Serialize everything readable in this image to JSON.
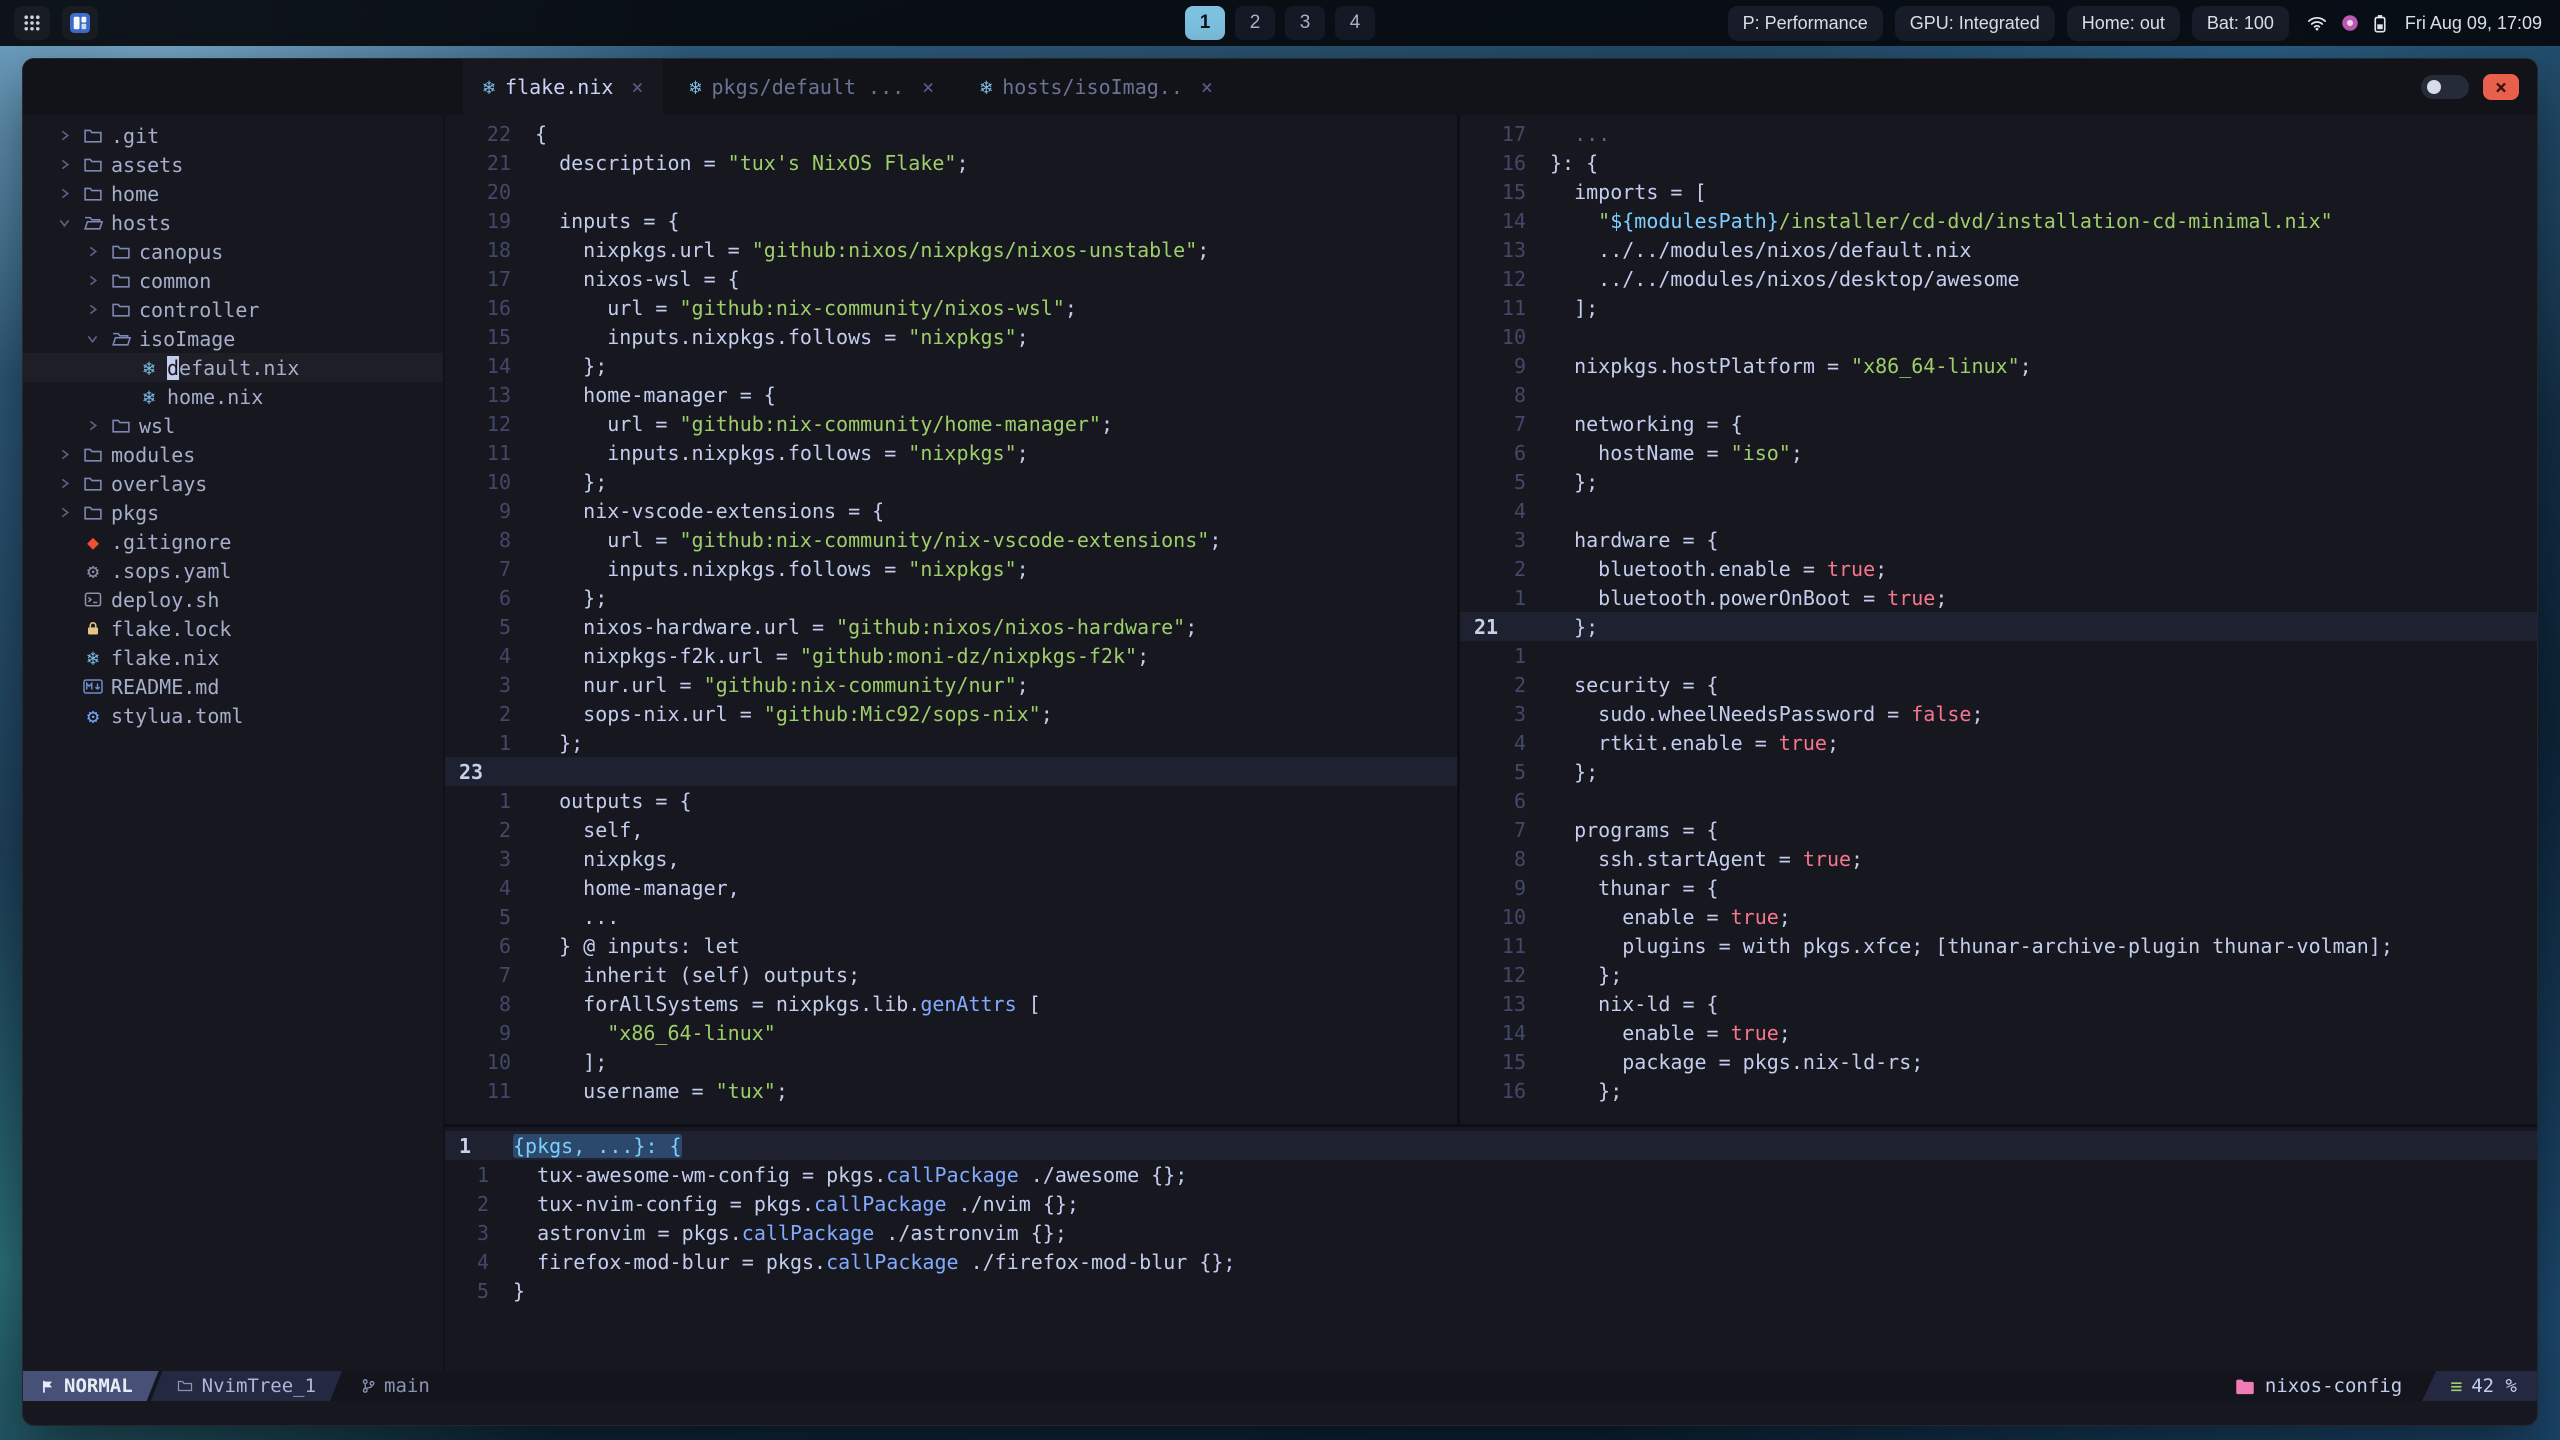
{
  "colors": {
    "bg_editor": "#16171f",
    "bg_tabbar": "#121319",
    "bg_statusline": "#14151c",
    "fg": "#c3cdee",
    "dim": "#5a6285",
    "linenr": "#424968",
    "linenr_active": "#c8d0ea",
    "string": "#9ece6a",
    "boolean": "#f7768e",
    "cyan": "#7dcfff",
    "func": "#82aaff",
    "accent": "#7fc4e4",
    "close": "#e8604c",
    "pink": "#ef7cb5",
    "mode_bg": "#475177",
    "seg_bg": "#242941",
    "tree_fg": "#a5aecb",
    "cursorline": "#1e2130",
    "selection": "#2c486a"
  },
  "icons": {
    "nix": "❄",
    "git": "◆",
    "gear": "⚙",
    "progress": "≡",
    "close_tab": "×",
    "close_window": "×"
  },
  "topbar": {
    "workspaces": [
      "1",
      "2",
      "3",
      "4"
    ],
    "active_workspace": "1",
    "status_pills": [
      "P: Performance",
      "GPU: Integrated",
      "Home: out",
      "Bat: 100"
    ],
    "clock": "Fri Aug 09, 17:09"
  },
  "window": {
    "tabs": [
      {
        "label": "flake.nix",
        "active": true
      },
      {
        "label": "pkgs/default ...",
        "active": false
      },
      {
        "label": "hosts/isoImag..",
        "active": false
      }
    ],
    "filetree": {
      "icon_colors": {
        "folder": "#7e88b5",
        "folder-open": "#7e88b5",
        "nix": "#7ebae4",
        "git": "#f14e32",
        "gear": "#8a91a8",
        "terminal": "#8a91a8",
        "lock": "#e6c384",
        "markdown": "#6d8ccc"
      },
      "items": [
        {
          "level": 0,
          "kind": "dir",
          "chev": "right",
          "icon": "folder",
          "label": ".git"
        },
        {
          "level": 0,
          "kind": "dir",
          "chev": "right",
          "icon": "folder",
          "label": "assets"
        },
        {
          "level": 0,
          "kind": "dir",
          "chev": "right",
          "icon": "folder",
          "label": "home"
        },
        {
          "level": 0,
          "kind": "dir",
          "chev": "down",
          "icon": "folder-open",
          "label": "hosts"
        },
        {
          "level": 1,
          "kind": "dir",
          "chev": "right",
          "icon": "folder",
          "label": "canopus"
        },
        {
          "level": 1,
          "kind": "dir",
          "chev": "right",
          "icon": "folder",
          "label": "common"
        },
        {
          "level": 1,
          "kind": "dir",
          "chev": "right",
          "icon": "folder",
          "label": "controller"
        },
        {
          "level": 1,
          "kind": "dir",
          "chev": "down",
          "icon": "folder-open",
          "label": "isoImage"
        },
        {
          "level": 2,
          "kind": "file",
          "icon": "nix",
          "label": "default.nix",
          "cursor": true
        },
        {
          "level": 2,
          "kind": "file",
          "icon": "nix",
          "label": "home.nix"
        },
        {
          "level": 1,
          "kind": "dir",
          "chev": "right",
          "icon": "folder",
          "label": "wsl"
        },
        {
          "level": 0,
          "kind": "dir",
          "chev": "right",
          "icon": "folder",
          "label": "modules"
        },
        {
          "level": 0,
          "kind": "dir",
          "chev": "right",
          "icon": "folder",
          "label": "overlays"
        },
        {
          "level": 0,
          "kind": "dir",
          "chev": "right",
          "icon": "folder",
          "label": "pkgs"
        },
        {
          "level": 0,
          "kind": "file",
          "icon": "git",
          "label": ".gitignore"
        },
        {
          "level": 0,
          "kind": "file",
          "icon": "gear",
          "label": ".sops.yaml"
        },
        {
          "level": 0,
          "kind": "file",
          "icon": "terminal",
          "label": "deploy.sh"
        },
        {
          "level": 0,
          "kind": "file",
          "icon": "lock",
          "label": "flake.lock"
        },
        {
          "level": 0,
          "kind": "file",
          "icon": "nix",
          "label": "flake.nix"
        },
        {
          "level": 0,
          "kind": "file",
          "icon": "markdown",
          "label": "README.md"
        },
        {
          "level": 0,
          "kind": "file",
          "icon": "gear",
          "label": "stylua.toml",
          "icon_color": "#7aa2f7"
        }
      ]
    },
    "pane_left": {
      "lines": [
        {
          "n": "22",
          "t": [
            [
              "w",
              "{"
            ]
          ]
        },
        {
          "n": "21",
          "t": [
            [
              "w",
              "  description = "
            ],
            [
              "s",
              "\"tux's NixOS Flake\""
            ],
            [
              "w",
              ";"
            ]
          ]
        },
        {
          "n": "20",
          "t": []
        },
        {
          "n": "19",
          "t": [
            [
              "w",
              "  inputs = {"
            ]
          ]
        },
        {
          "n": "18",
          "t": [
            [
              "w",
              "    nixpkgs.url = "
            ],
            [
              "s",
              "\"github:nixos/nixpkgs/nixos-unstable\""
            ],
            [
              "w",
              ";"
            ]
          ]
        },
        {
          "n": "17",
          "t": [
            [
              "w",
              "    nixos-wsl = {"
            ]
          ]
        },
        {
          "n": "16",
          "t": [
            [
              "w",
              "      url = "
            ],
            [
              "s",
              "\"github:nix-community/nixos-wsl\""
            ],
            [
              "w",
              ";"
            ]
          ]
        },
        {
          "n": "15",
          "t": [
            [
              "w",
              "      inputs.nixpkgs.follows = "
            ],
            [
              "s",
              "\"nixpkgs\""
            ],
            [
              "w",
              ";"
            ]
          ]
        },
        {
          "n": "14",
          "t": [
            [
              "w",
              "    };"
            ]
          ]
        },
        {
          "n": "13",
          "t": [
            [
              "w",
              "    home-manager = {"
            ]
          ]
        },
        {
          "n": "12",
          "t": [
            [
              "w",
              "      url = "
            ],
            [
              "s",
              "\"github:nix-community/home-manager\""
            ],
            [
              "w",
              ";"
            ]
          ]
        },
        {
          "n": "11",
          "t": [
            [
              "w",
              "      inputs.nixpkgs.follows = "
            ],
            [
              "s",
              "\"nixpkgs\""
            ],
            [
              "w",
              ";"
            ]
          ]
        },
        {
          "n": "10",
          "t": [
            [
              "w",
              "    };"
            ]
          ]
        },
        {
          "n": "9",
          "t": [
            [
              "w",
              "    nix-vscode-extensions = {"
            ]
          ]
        },
        {
          "n": "8",
          "t": [
            [
              "w",
              "      url = "
            ],
            [
              "s",
              "\"github:nix-community/nix-vscode-extensions\""
            ],
            [
              "w",
              ";"
            ]
          ]
        },
        {
          "n": "7",
          "t": [
            [
              "w",
              "      inputs.nixpkgs.follows = "
            ],
            [
              "s",
              "\"nixpkgs\""
            ],
            [
              "w",
              ";"
            ]
          ]
        },
        {
          "n": "6",
          "t": [
            [
              "w",
              "    };"
            ]
          ]
        },
        {
          "n": "5",
          "t": [
            [
              "w",
              "    nixos-hardware.url = "
            ],
            [
              "s",
              "\"github:nixos/nixos-hardware\""
            ],
            [
              "w",
              ";"
            ]
          ]
        },
        {
          "n": "4",
          "t": [
            [
              "w",
              "    nixpkgs-f2k.url = "
            ],
            [
              "s",
              "\"github:moni-dz/nixpkgs-f2k\""
            ],
            [
              "w",
              ";"
            ]
          ]
        },
        {
          "n": "3",
          "t": [
            [
              "w",
              "    nur.url = "
            ],
            [
              "s",
              "\"github:nix-community/nur\""
            ],
            [
              "w",
              ";"
            ]
          ]
        },
        {
          "n": "2",
          "t": [
            [
              "w",
              "    sops-nix.url = "
            ],
            [
              "s",
              "\"github:Mic92/sops-nix\""
            ],
            [
              "w",
              ";"
            ]
          ]
        },
        {
          "n": "1",
          "t": [
            [
              "w",
              "  };"
            ]
          ]
        },
        {
          "n": "23",
          "cur": true,
          "t": []
        },
        {
          "n": "1",
          "t": [
            [
              "w",
              "  outputs = {"
            ]
          ]
        },
        {
          "n": "2",
          "t": [
            [
              "w",
              "    self,"
            ]
          ]
        },
        {
          "n": "3",
          "t": [
            [
              "w",
              "    nixpkgs,"
            ]
          ]
        },
        {
          "n": "4",
          "t": [
            [
              "w",
              "    home-manager,"
            ]
          ]
        },
        {
          "n": "5",
          "t": [
            [
              "w",
              "    ..."
            ]
          ]
        },
        {
          "n": "6",
          "t": [
            [
              "w",
              "  } @ inputs: let"
            ]
          ]
        },
        {
          "n": "7",
          "t": [
            [
              "w",
              "    inherit (self) outputs;"
            ]
          ]
        },
        {
          "n": "8",
          "t": [
            [
              "w",
              "    forAllSystems = nixpkgs.lib."
            ],
            [
              "f",
              "genAttrs"
            ],
            [
              "w",
              " ["
            ]
          ]
        },
        {
          "n": "9",
          "t": [
            [
              "s",
              "      \"x86_64-linux\""
            ]
          ]
        },
        {
          "n": "10",
          "t": [
            [
              "w",
              "    ];"
            ]
          ]
        },
        {
          "n": "11",
          "t": [
            [
              "w",
              "    username = "
            ],
            [
              "s",
              "\"tux\""
            ],
            [
              "w",
              ";"
            ]
          ]
        }
      ]
    },
    "pane_right": {
      "lines": [
        {
          "n": "17",
          "t": [
            [
              "d",
              "  ..."
            ]
          ]
        },
        {
          "n": "16",
          "t": [
            [
              "w",
              "}: {"
            ]
          ]
        },
        {
          "n": "15",
          "t": [
            [
              "w",
              "  imports = ["
            ]
          ]
        },
        {
          "n": "14",
          "t": [
            [
              "s",
              "    \""
            ],
            [
              "c",
              "${modulesPath}"
            ],
            [
              "s",
              "/installer/cd-dvd/installation-cd-minimal.nix\""
            ]
          ]
        },
        {
          "n": "13",
          "t": [
            [
              "w",
              "    ../../modules/nixos/default.nix"
            ]
          ]
        },
        {
          "n": "12",
          "t": [
            [
              "w",
              "    ../../modules/nixos/desktop/awesome"
            ]
          ]
        },
        {
          "n": "11",
          "t": [
            [
              "w",
              "  ];"
            ]
          ]
        },
        {
          "n": "10",
          "t": []
        },
        {
          "n": "9",
          "t": [
            [
              "w",
              "  nixpkgs.hostPlatform = "
            ],
            [
              "s",
              "\"x86_64-linux\""
            ],
            [
              "w",
              ";"
            ]
          ]
        },
        {
          "n": "8",
          "t": []
        },
        {
          "n": "7",
          "t": [
            [
              "w",
              "  networking = {"
            ]
          ]
        },
        {
          "n": "6",
          "t": [
            [
              "w",
              "    hostName = "
            ],
            [
              "s",
              "\"iso\""
            ],
            [
              "w",
              ";"
            ]
          ]
        },
        {
          "n": "5",
          "t": [
            [
              "w",
              "  };"
            ]
          ]
        },
        {
          "n": "4",
          "t": []
        },
        {
          "n": "3",
          "t": [
            [
              "w",
              "  hardware = {"
            ]
          ]
        },
        {
          "n": "2",
          "t": [
            [
              "w",
              "    bluetooth.enable = "
            ],
            [
              "b",
              "true"
            ],
            [
              "w",
              ";"
            ]
          ]
        },
        {
          "n": "1",
          "t": [
            [
              "w",
              "    bluetooth.powerOnBoot = "
            ],
            [
              "b",
              "true"
            ],
            [
              "w",
              ";"
            ]
          ]
        },
        {
          "n": "21",
          "cur": true,
          "t": [
            [
              "w",
              "  };"
            ]
          ]
        },
        {
          "n": "1",
          "t": []
        },
        {
          "n": "2",
          "t": [
            [
              "w",
              "  security = {"
            ]
          ]
        },
        {
          "n": "3",
          "t": [
            [
              "w",
              "    sudo.wheelNeedsPassword = "
            ],
            [
              "b",
              "false"
            ],
            [
              "w",
              ";"
            ]
          ]
        },
        {
          "n": "4",
          "t": [
            [
              "w",
              "    rtkit.enable = "
            ],
            [
              "b",
              "true"
            ],
            [
              "w",
              ";"
            ]
          ]
        },
        {
          "n": "5",
          "t": [
            [
              "w",
              "  };"
            ]
          ]
        },
        {
          "n": "6",
          "t": []
        },
        {
          "n": "7",
          "t": [
            [
              "w",
              "  programs = {"
            ]
          ]
        },
        {
          "n": "8",
          "t": [
            [
              "w",
              "    ssh.startAgent = "
            ],
            [
              "b",
              "true"
            ],
            [
              "w",
              ";"
            ]
          ]
        },
        {
          "n": "9",
          "t": [
            [
              "w",
              "    thunar = {"
            ]
          ]
        },
        {
          "n": "10",
          "t": [
            [
              "w",
              "      enable = "
            ],
            [
              "b",
              "true"
            ],
            [
              "w",
              ";"
            ]
          ]
        },
        {
          "n": "11",
          "t": [
            [
              "w",
              "      plugins = with pkgs.xfce; [thunar-archive-plugin thunar-volman];"
            ]
          ]
        },
        {
          "n": "12",
          "t": [
            [
              "w",
              "    };"
            ]
          ]
        },
        {
          "n": "13",
          "t": [
            [
              "w",
              "    nix-ld = {"
            ]
          ]
        },
        {
          "n": "14",
          "t": [
            [
              "w",
              "      enable = "
            ],
            [
              "b",
              "true"
            ],
            [
              "w",
              ";"
            ]
          ]
        },
        {
          "n": "15",
          "t": [
            [
              "w",
              "      package = pkgs.nix-ld-rs;"
            ]
          ]
        },
        {
          "n": "16",
          "t": [
            [
              "w",
              "    };"
            ]
          ]
        }
      ]
    },
    "pane_bottom": {
      "lines": [
        {
          "n": "1",
          "cur": true,
          "sel": true,
          "t": [
            [
              "c",
              "{pkgs, ...}: {"
            ]
          ]
        },
        {
          "n": "1",
          "t": [
            [
              "w",
              "  tux-awesome-wm-config = pkgs."
            ],
            [
              "f",
              "callPackage"
            ],
            [
              "w",
              " ./awesome {};"
            ]
          ]
        },
        {
          "n": "2",
          "t": [
            [
              "w",
              "  tux-nvim-config = pkgs."
            ],
            [
              "f",
              "callPackage"
            ],
            [
              "w",
              " ./nvim {};"
            ]
          ]
        },
        {
          "n": "3",
          "t": [
            [
              "w",
              "  astronvim = pkgs."
            ],
            [
              "f",
              "callPackage"
            ],
            [
              "w",
              " ./astronvim {};"
            ]
          ]
        },
        {
          "n": "4",
          "t": [
            [
              "w",
              "  firefox-mod-blur = pkgs."
            ],
            [
              "f",
              "callPackage"
            ],
            [
              "w",
              " ./firefox-mod-blur {};"
            ]
          ]
        },
        {
          "n": "5",
          "t": [
            [
              "w",
              "}"
            ]
          ]
        }
      ]
    },
    "statusline": {
      "mode": "NORMAL",
      "buffer": "NvimTree_1",
      "branch": "main",
      "project": "nixos-config",
      "scroll": "42 %"
    }
  }
}
